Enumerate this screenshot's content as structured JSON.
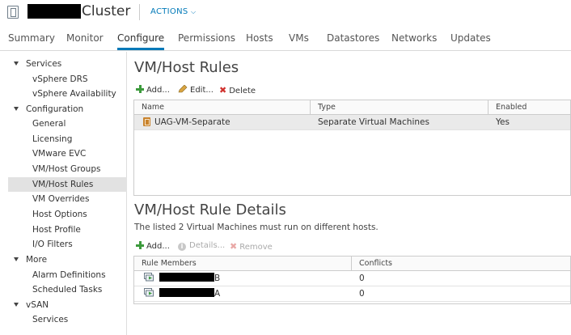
{
  "header": {
    "title": "Cluster",
    "actions_label": "ACTIONS"
  },
  "tabs": [
    {
      "label": "Summary"
    },
    {
      "label": "Monitor"
    },
    {
      "label": "Configure"
    },
    {
      "label": "Permissions"
    },
    {
      "label": "Hosts"
    },
    {
      "label": "VMs"
    },
    {
      "label": "Datastores"
    },
    {
      "label": "Networks"
    },
    {
      "label": "Updates"
    }
  ],
  "active_tab": "Configure",
  "sidebar": {
    "services_label": "Services",
    "services": [
      "vSphere DRS",
      "vSphere Availability"
    ],
    "configuration_label": "Configuration",
    "configuration": [
      "General",
      "Licensing",
      "VMware EVC",
      "VM/Host Groups",
      "VM/Host Rules",
      "VM Overrides",
      "Host Options",
      "Host Profile",
      "I/O Filters"
    ],
    "more_label": "More",
    "more": [
      "Alarm Definitions",
      "Scheduled Tasks"
    ],
    "vsan_label": "vSAN",
    "vsan": [
      "Services"
    ],
    "selected": "VM/Host Rules"
  },
  "rules": {
    "heading": "VM/Host Rules",
    "add_label": "Add...",
    "edit_label": "Edit...",
    "delete_label": "Delete",
    "columns": [
      "Name",
      "Type",
      "Enabled"
    ],
    "rows": [
      {
        "name": "UAG-VM-Separate",
        "type": "Separate Virtual Machines",
        "enabled": "Yes"
      }
    ]
  },
  "details": {
    "heading": "VM/Host Rule Details",
    "description": "The listed 2 Virtual Machines must run on different hosts.",
    "add_label": "Add...",
    "details_label": "Details...",
    "remove_label": "Remove",
    "columns": [
      "Rule Members",
      "Conflicts"
    ],
    "rows": [
      {
        "member_suffix": "B",
        "conflicts": "0"
      },
      {
        "member_suffix": "A",
        "conflicts": "0"
      }
    ]
  },
  "colors": {
    "accent": "#0079b8",
    "add_green": "#3c9a3c",
    "delete_red": "#d0312d",
    "selected_bg": "#e2e2e2"
  },
  "icons": [
    "cluster-icon",
    "chevron-down-icon",
    "plus-icon",
    "pencil-icon",
    "delete-x-icon",
    "info-icon",
    "rule-icon",
    "vm-icon",
    "caret-down-icon"
  ]
}
